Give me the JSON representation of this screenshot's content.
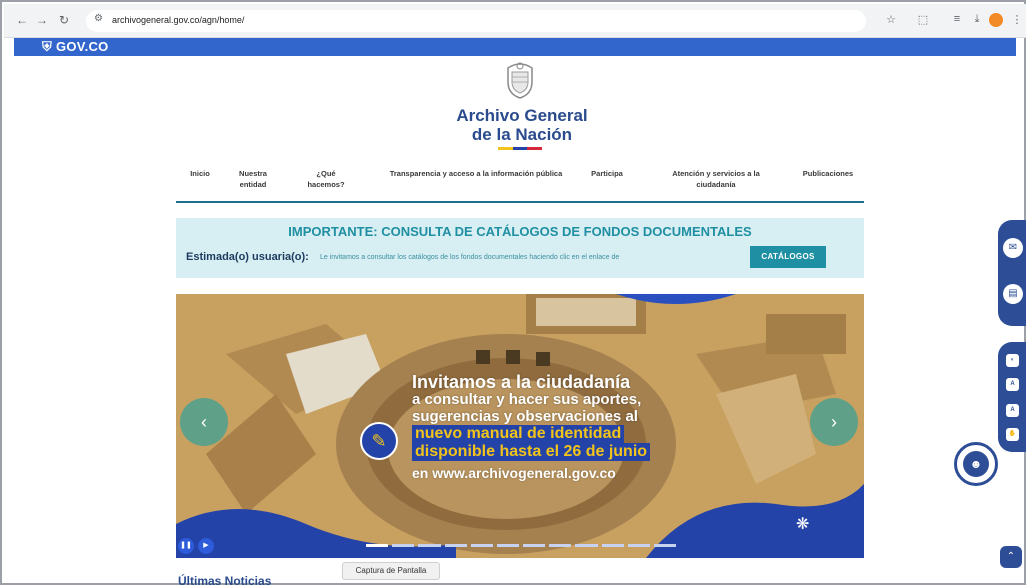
{
  "browser": {
    "url": "archivogeneral.gov.co/agn/home/",
    "back_icon": "back-arrow-icon",
    "forward_icon": "forward-arrow-icon",
    "reload_icon": "reload-icon"
  },
  "gov_bar": {
    "logo_text": "GOV.CO"
  },
  "header": {
    "title_line1": "Archivo General",
    "title_line2": "de la Nación",
    "flag_colors": [
      "#f2c31a",
      "#2443a8",
      "#d6283a"
    ]
  },
  "nav": {
    "items": [
      {
        "label": "Inicio"
      },
      {
        "label": "Nuestra entidad"
      },
      {
        "label": "¿Qué hacemos?"
      },
      {
        "label": "Transparencia y acceso a la información pública"
      },
      {
        "label": "Participa"
      },
      {
        "label": "Atención y servicios a la ciudadanía"
      },
      {
        "label": "Publicaciones"
      }
    ]
  },
  "notice": {
    "title": "IMPORTANTE: CONSULTA DE CATÁLOGOS DE FONDOS DOCUMENTALES",
    "greeting": "Estimada(o) usuaria(o):",
    "text": "Le invitamos a consultar los catálogos de los fondos documentales haciendo clic en el enlace de",
    "button_label": "CATÁLOGOS"
  },
  "banner": {
    "line1": "Invitamos a la ciudadanía",
    "line2": "a consultar y hacer sus aportes,",
    "line3": "sugerencias y observaciones al",
    "line4": "nuevo manual de identidad",
    "line5": "disponible hasta el 26 de junio",
    "line6": "en www.archivogeneral.gov.co",
    "slide_count": 12,
    "active_slide": 1
  },
  "bottom": {
    "heading": "Últimas Noticias",
    "tooltip": "Captura de Pantalla"
  },
  "colors": {
    "gov_blue": "#3366cc",
    "brand_navy": "#2a4b8d",
    "teal": "#1f8fa3",
    "rail": "#2d4d96"
  }
}
